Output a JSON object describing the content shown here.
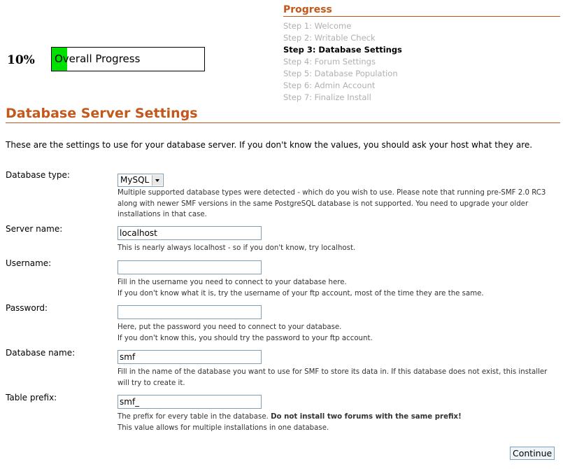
{
  "progress": {
    "title": "Progress",
    "steps": [
      "Step 1: Welcome",
      "Step 2: Writable Check",
      "Step 3: Database Settings",
      "Step 4: Forum Settings",
      "Step 5: Database Population",
      "Step 6: Admin Account",
      "Step 7: Finalize Install"
    ],
    "active_step_index": 2
  },
  "overall": {
    "percent_label": "10%",
    "bar_label": "Overall Progress",
    "percent_value": 10,
    "fill_color": "#00e000"
  },
  "section": {
    "title": "Database Server Settings"
  },
  "intro": "These are the settings to use for your database server. If you don't know the values, you should ask your host what they are.",
  "fields": {
    "db_type": {
      "label": "Database type:",
      "value": "MySQL",
      "desc": "Multiple supported database types were detected - which do you wish to use. Please note that running pre-SMF 2.0 RC3 along with newer SMF versions in the same PostgreSQL database is not supported. You need to upgrade your older installations in that case."
    },
    "server": {
      "label": "Server name:",
      "value": "localhost",
      "desc": "This is nearly always localhost - so if you don't know, try localhost."
    },
    "username": {
      "label": "Username:",
      "value": "",
      "desc1": "Fill in the username you need to connect to your database here.",
      "desc2": "If you don't know what it is, try the username of your ftp account, most of the time they are the same."
    },
    "password": {
      "label": "Password:",
      "value": "",
      "desc1": "Here, put the password you need to connect to your database.",
      "desc2": "If you don't know this, you should try the password to your ftp account."
    },
    "db_name": {
      "label": "Database name:",
      "value": "smf",
      "desc": "Fill in the name of the database you want to use for SMF to store its data in. If this database does not exist, this installer will try to create it."
    },
    "prefix": {
      "label": "Table prefix:",
      "value": "smf_",
      "desc_a": "The prefix for every table in the database.",
      "desc_bold": "Do not install two forums with the same prefix!",
      "desc2": "This value allows for multiple installations in one database."
    }
  },
  "buttons": {
    "continue": "Continue"
  },
  "colors": {
    "accent": "#c2581b",
    "inactive_step": "#b0b0b0",
    "input_border": "#7f9db9"
  }
}
